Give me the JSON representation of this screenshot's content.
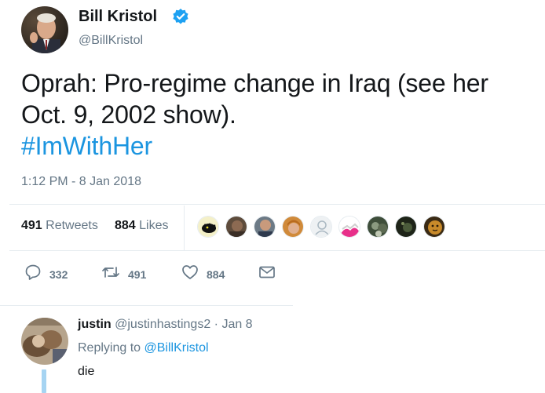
{
  "tweet": {
    "author_name": "Bill Kristol",
    "author_handle": "@BillKristol",
    "text_line1": "Oprah: Pro-regime change in Iraq (see her",
    "text_line2": "Oct. 9, 2002 show).",
    "hashtag": "#ImWithHer",
    "timestamp": "1:12 PM - 8 Jan 2018",
    "stats": {
      "retweets_count": "491",
      "retweets_label": "Retweets",
      "likes_count": "884",
      "likes_label": "Likes"
    },
    "actions": {
      "reply_count": "332",
      "retweet_count": "491",
      "like_count": "884"
    }
  },
  "reply": {
    "author_name": "justin",
    "author_handle": "@justinhastings2",
    "separator": " · ",
    "date": "Jan 8",
    "replying_to_label": "Replying to ",
    "replying_to_handle": "@BillKristol",
    "text": "die"
  },
  "colors": {
    "accent": "#1b95e0",
    "verified": "#1da1f2",
    "muted": "#657786"
  }
}
